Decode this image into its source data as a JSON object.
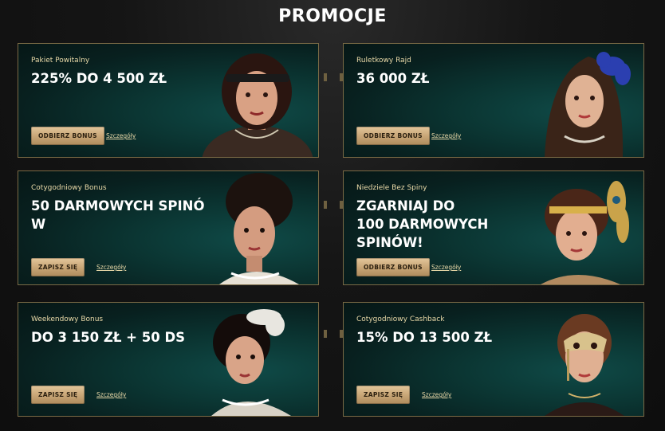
{
  "page": {
    "title": "PROMOCJE"
  },
  "cards": [
    {
      "label": "Pakiet Powitalny",
      "headline": "225% DO 4 500 ZŁ",
      "cta": "ODBIERZ BONUS",
      "details": "Szczegóły"
    },
    {
      "label": "Ruletkowy Rajd",
      "headline": "36 000 ZŁ",
      "cta": "ODBIERZ BONUS",
      "details": "Szczegóły"
    },
    {
      "label": "Cotygodniowy Bonus",
      "headline": "50 DARMOWYCH SPINÓ\nW",
      "cta": "ZAPISZ SIĘ",
      "details": "Szczegóły"
    },
    {
      "label": "Niedziele Bez Spiny",
      "headline": "ZGARNIAJ DO\n100 DARMOWYCH\nSPINÓW!",
      "cta": "ODBIERZ BONUS",
      "details": "Szczegóły"
    },
    {
      "label": "Weekendowy Bonus",
      "headline": "DO 3 150 ZŁ + 50 DS",
      "cta": "ZAPISZ SIĘ",
      "details": "Szczegóły"
    },
    {
      "label": "Cotygodniowy Cashback",
      "headline": "15% DO 13 500 ZŁ",
      "cta": "ZAPISZ SIĘ",
      "details": "Szczegóły"
    }
  ],
  "colors": {
    "gold": "#e9d9a8",
    "button": "#c9a778",
    "card_bg": "#0b3633",
    "border": "#7a6a45"
  }
}
